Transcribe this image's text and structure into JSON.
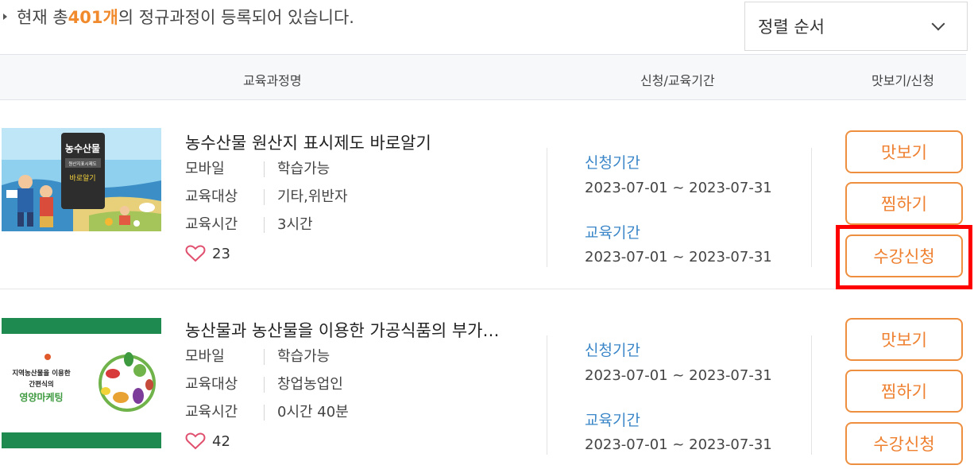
{
  "summary": {
    "prefix": "현재 총 ",
    "count": "401개",
    "suffix": "의 정규과정이 등록되어 있습니다."
  },
  "sort": {
    "label": "정렬 순서"
  },
  "table_header": {
    "name": "교육과정명",
    "period": "신청/교육기간",
    "actions": "맛보기/신청"
  },
  "courses": [
    {
      "title": "농수산물 원산지 표시제도 바로알기",
      "thumbnail_text": [
        "농수산물",
        "원산지표시제도",
        "바로알기"
      ],
      "meta": [
        {
          "key": "모바일",
          "value": "학습가능"
        },
        {
          "key": "교육대상",
          "value": "기타,위반자"
        },
        {
          "key": "교육시간",
          "value": "3시간"
        }
      ],
      "likes": "23",
      "apply_label": "신청기간",
      "apply_period": "2023-07-01 ~ 2023-07-31",
      "edu_label": "교육기간",
      "edu_period": "2023-07-01 ~ 2023-07-31",
      "buttons": {
        "preview": "맛보기",
        "wishlist": "찜하기",
        "enroll": "수강신청"
      }
    },
    {
      "title": "농산물과 농산물을 이용한 가공식품의 부가…",
      "thumbnail_text": [
        "지역농산물을 이용한",
        "간편식의",
        "영양마케팅"
      ],
      "meta": [
        {
          "key": "모바일",
          "value": "학습가능"
        },
        {
          "key": "교육대상",
          "value": "창업농업인"
        },
        {
          "key": "교육시간",
          "value": "0시간 40분"
        }
      ],
      "likes": "42",
      "apply_label": "신청기간",
      "apply_period": "2023-07-01 ~ 2023-07-31",
      "edu_label": "교육기간",
      "edu_period": "2023-07-01 ~ 2023-07-31",
      "buttons": {
        "preview": "맛보기",
        "wishlist": "찜하기",
        "enroll": "수강신청"
      }
    }
  ],
  "colors": {
    "accent": "#ee8030",
    "link_blue": "#3a86c8",
    "highlight": "#ff0000"
  }
}
